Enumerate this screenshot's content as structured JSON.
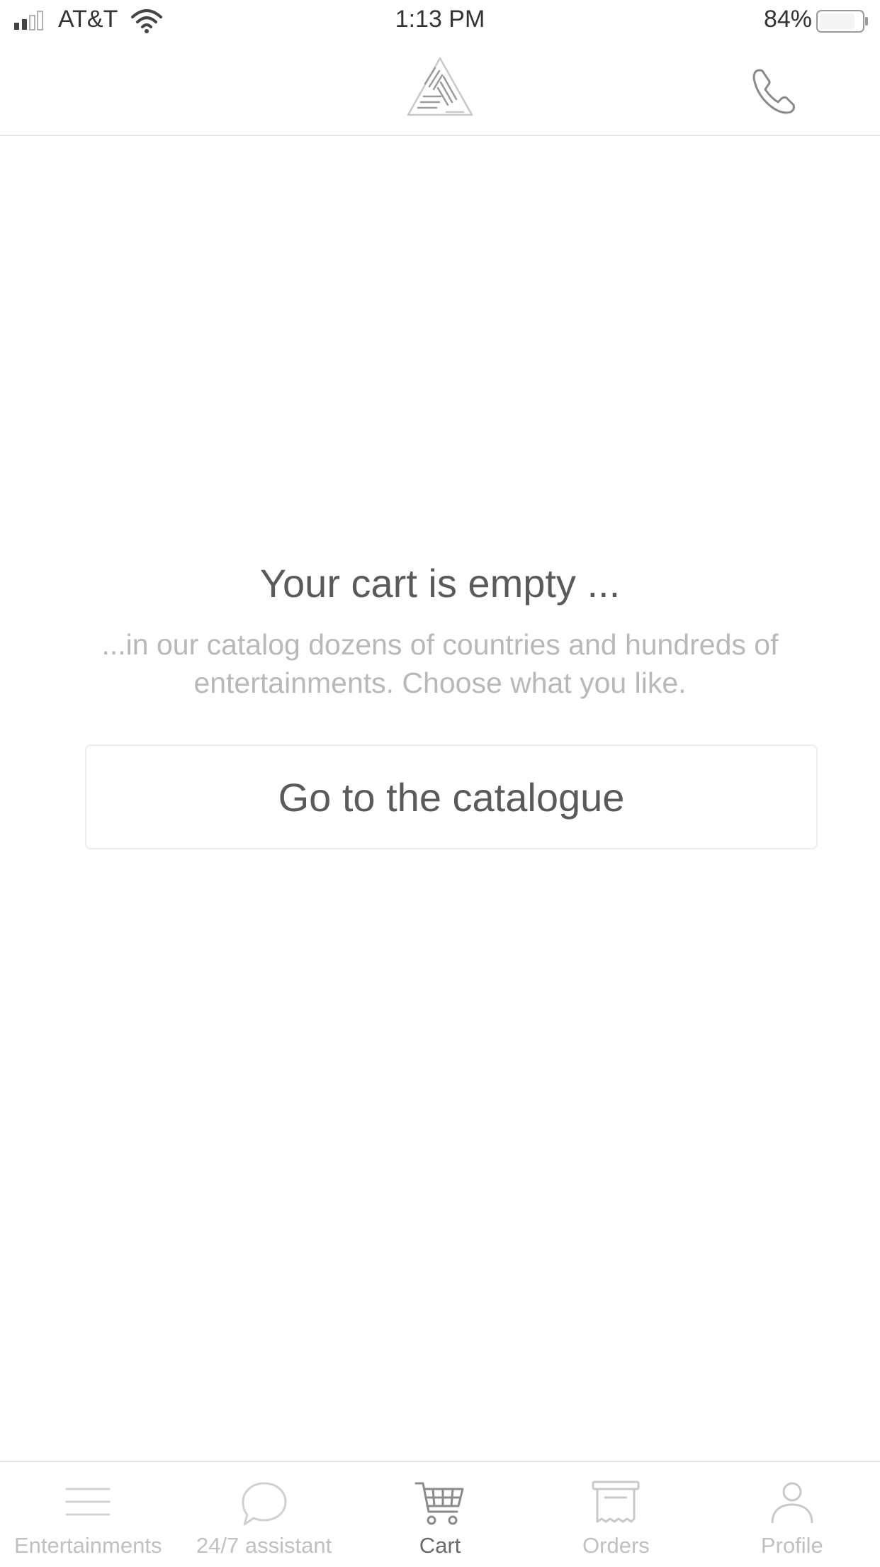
{
  "status_bar": {
    "carrier": "AT&T",
    "time": "1:13 PM",
    "battery_percent": "84%",
    "battery_level": 0.84,
    "signal_icon": "signal-bars-icon",
    "wifi_icon": "wifi-icon",
    "battery_icon": "battery-icon"
  },
  "nav_bar": {
    "logo_icon": "hands-triangle-logo",
    "phone_icon": "phone-icon"
  },
  "empty_state": {
    "title": "Your cart is empty ...",
    "subtitle": "...in our catalog dozens of countries and hundreds of entertainments. Choose what you like.",
    "button_label": "Go to the catalogue"
  },
  "tab_bar": {
    "tabs": [
      {
        "label": "Entertainments",
        "icon": "menu-lines-icon",
        "active": false
      },
      {
        "label": "24/7 assistant",
        "icon": "chat-bubble-icon",
        "active": false
      },
      {
        "label": "Cart",
        "icon": "cart-icon",
        "active": true
      },
      {
        "label": "Orders",
        "icon": "receipt-icon",
        "active": false
      },
      {
        "label": "Profile",
        "icon": "person-icon",
        "active": false
      }
    ]
  },
  "colors": {
    "background": "#ffffff",
    "text_primary": "#5a5a5a",
    "text_secondary": "#b8b8b8",
    "tab_inactive": "#c0c0c0",
    "tab_active": "#6a6a6a",
    "divider": "#e2e2e2"
  }
}
